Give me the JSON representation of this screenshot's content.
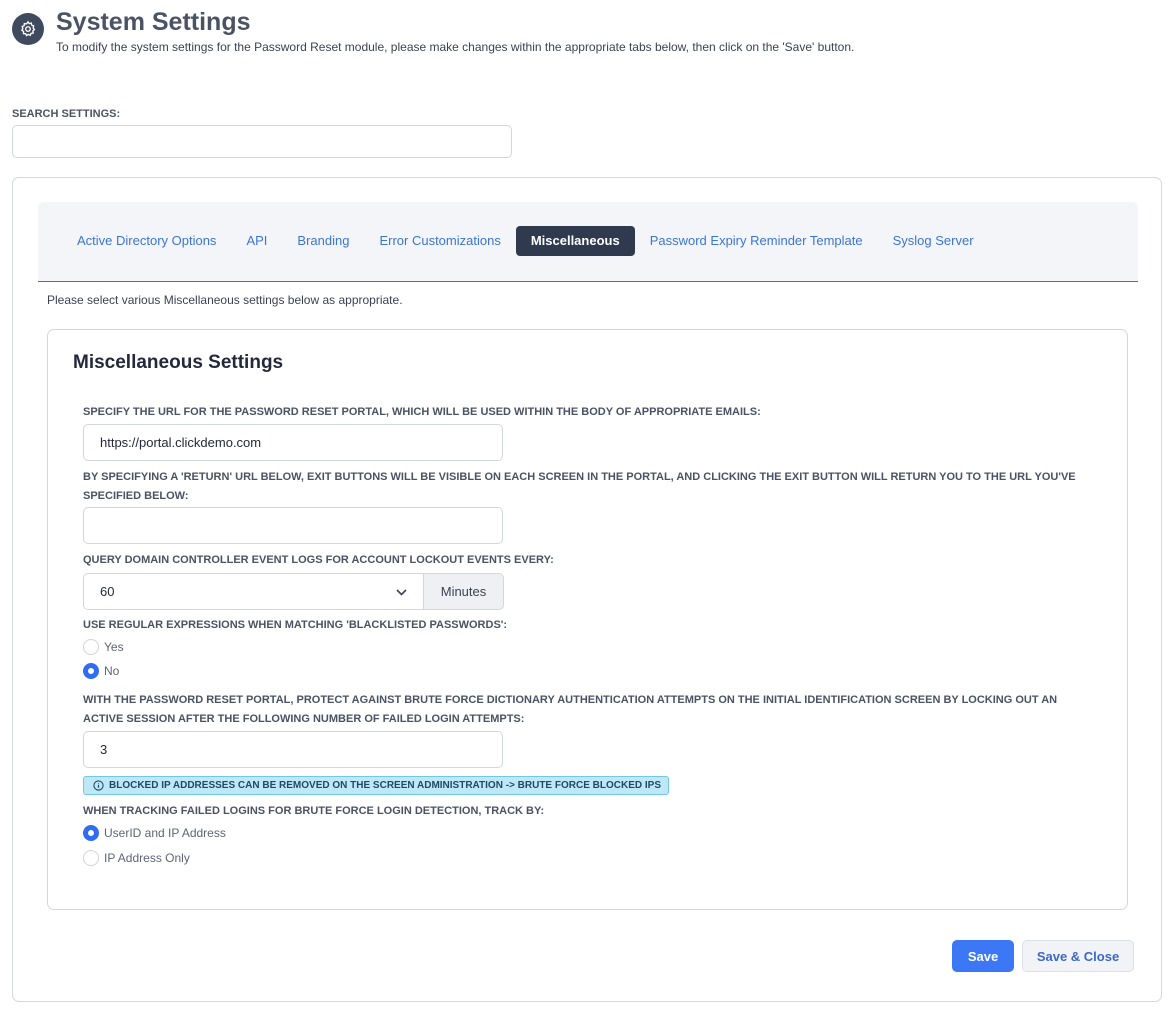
{
  "header": {
    "icon": "gear-icon",
    "title": "System Settings",
    "subtitle": "To modify the system settings for the Password Reset module, please make changes within the appropriate tabs below, then click on the 'Save' button."
  },
  "search": {
    "label": "SEARCH SETTINGS:",
    "value": ""
  },
  "tabs": [
    {
      "label": "Active Directory Options",
      "active": false
    },
    {
      "label": "API",
      "active": false
    },
    {
      "label": "Branding",
      "active": false
    },
    {
      "label": "Error Customizations",
      "active": false
    },
    {
      "label": "Miscellaneous",
      "active": true
    },
    {
      "label": "Password Expiry Reminder Template",
      "active": false
    },
    {
      "label": "Syslog Server",
      "active": false
    }
  ],
  "tab_description": "Please select various Miscellaneous settings below as appropriate.",
  "misc": {
    "title": "Miscellaneous Settings",
    "portal_url": {
      "label": "SPECIFY THE URL FOR THE PASSWORD RESET PORTAL, WHICH WILL BE USED WITHIN THE BODY OF APPROPRIATE EMAILS:",
      "value": "https://portal.clickdemo.com"
    },
    "return_url": {
      "label": "BY SPECIFYING A 'RETURN' URL BELOW, EXIT BUTTONS WILL BE VISIBLE ON EACH SCREEN IN THE PORTAL, AND CLICKING THE EXIT BUTTON WILL RETURN YOU TO THE URL YOU'VE SPECIFIED BELOW:",
      "value": ""
    },
    "query_interval": {
      "label": "QUERY DOMAIN CONTROLLER EVENT LOGS FOR ACCOUNT LOCKOUT EVENTS EVERY:",
      "value": "60",
      "unit": "Minutes"
    },
    "regex": {
      "label": "USE REGULAR EXPRESSIONS WHEN MATCHING 'BLACKLISTED PASSWORDS':",
      "options": [
        "Yes",
        "No"
      ],
      "selected": "No"
    },
    "brute_force": {
      "label": "WITH THE PASSWORD RESET PORTAL, PROTECT AGAINST BRUTE FORCE DICTIONARY AUTHENTICATION ATTEMPTS ON THE INITIAL IDENTIFICATION SCREEN BY LOCKING OUT AN ACTIVE SESSION AFTER THE FOLLOWING NUMBER OF FAILED LOGIN ATTEMPTS:",
      "value": "3",
      "info": "BLOCKED IP ADDRESSES CAN BE REMOVED ON THE SCREEN ADMINISTRATION -> BRUTE FORCE BLOCKED IPS"
    },
    "tracking": {
      "label": "WHEN TRACKING FAILED LOGINS FOR BRUTE FORCE LOGIN DETECTION, TRACK BY:",
      "options": [
        "UserID and IP Address",
        "IP Address Only"
      ],
      "selected": "UserID and IP Address"
    }
  },
  "buttons": {
    "save": "Save",
    "save_close": "Save & Close"
  },
  "colors": {
    "accent": "#3c78f5",
    "active_tab": "#2f3a4e",
    "tab_link": "#3c75d8",
    "info_bg": "#bfe8f7"
  }
}
